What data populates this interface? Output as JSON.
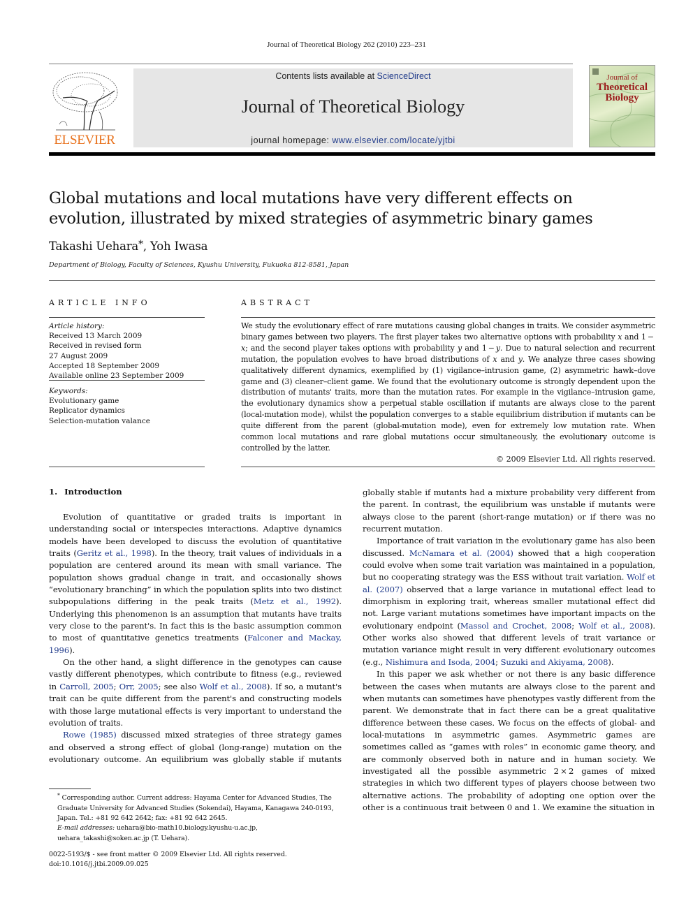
{
  "running_head": "Journal of Theoretical Biology 262 (2010) 223–231",
  "masthead": {
    "publisher": "ELSEVIER",
    "contents_prefix": "Contents lists available at ",
    "contents_link": "ScienceDirect",
    "journal_name": "Journal of Theoretical Biology",
    "homepage_prefix": "journal homepage: ",
    "homepage_link": "www.elsevier.com/locate/yjtbi",
    "cover": {
      "line1": "Journal of",
      "line2": "Theoretical",
      "line3": "Biology"
    }
  },
  "article": {
    "title": "Global mutations and local mutations have very different effects on evolution, illustrated by mixed strategies of asymmetric binary games",
    "author1": "Takashi Uehara",
    "author1_mark": "*",
    "author_sep": ", ",
    "author2": "Yoh Iwasa",
    "affiliation": "Department of Biology, Faculty of Sciences, Kyushu University, Fukuoka 812-8581, Japan"
  },
  "article_info": {
    "heading": "ARTICLE INFO",
    "history_label": "Article history:",
    "history": [
      "Received 13 March 2009",
      "Received in revised form",
      "27 August 2009",
      "Accepted 18 September 2009",
      "Available online 23 September 2009"
    ],
    "keywords_label": "Keywords:",
    "keywords": [
      "Evolutionary game",
      "Replicator dynamics",
      "Selection-mutation valance"
    ]
  },
  "abstract": {
    "heading": "ABSTRACT",
    "s1": "We study the evolutionary effect of rare mutations causing global changes in traits. We consider asymmetric binary games between two players. The first player takes two alternative options with probability ",
    "x": "x",
    "s2": " and 1 − ",
    "s3": "; and the second player takes options with probability ",
    "y": "y",
    "s4": " and 1 − ",
    "s5": ". Due to natural selection and recurrent mutation, the population evolves to have broad distributions of ",
    "s6": " and ",
    "s7": ". We analyze three cases showing qualitatively different dynamics, exemplified by (1) vigilance–intrusion game, (2) asymmetric hawk–dove game and (3) cleaner–client game. We found that the evolutionary outcome is strongly dependent upon the distribution of mutants' traits, more than the mutation rates. For example in the vigilance–intrusion game, the evolutionary dynamics show a perpetual stable oscillation if mutants are always close to the parent (local-mutation mode), whilst the population converges to a stable equilibrium distribution if mutants can be quite different from the parent (global-mutation mode), even for extremely low mutation rate. When common local mutations and rare global mutations occur simultaneously, the evolutionary outcome is controlled by the latter.",
    "copyright": "© 2009 Elsevier Ltd. All rights reserved."
  },
  "introduction": {
    "number": "1.",
    "heading": "Introduction",
    "p1_a": "Evolution of quantitative or graded traits is important in understanding social or interspecies interactions. Adaptive dynamics models have been developed to discuss the evolution of quantitative traits (",
    "p1_ref1": "Geritz et al., 1998",
    "p1_b": "). In the theory, trait values of individuals in a population are centered around its mean with small variance. The population shows gradual change in trait, and occasionally shows “evolutionary branching” in which the population splits into two distinct subpopulations differing in the peak traits (",
    "p1_ref2": "Metz et al., 1992",
    "p1_c": "). Underlying this phenomenon is an assumption that mutants have traits very close to the parent's. In fact this is the basic assumption common to most of quantitative genetics treatments (",
    "p1_ref3": "Falconer and Mackay, 1996",
    "p1_d": ").",
    "p2_a": "On the other hand, a slight difference in the genotypes can cause vastly different phenotypes, which contribute to fitness (e.g., reviewed in ",
    "p2_ref1": "Carroll, 2005",
    "p2_b": "; ",
    "p2_ref2": "Orr, 2005",
    "p2_c": "; see also ",
    "p2_ref3": "Wolf et al., 2008",
    "p2_d": "). If so, a mutant's trait can be quite different from the parent's and constructing models with those large mutational effects is very important to understand the evolution of traits.",
    "p3_ref1": "Rowe (1985)",
    "p3_a": " discussed mixed strategies of three strategy games and observed a strong effect of global (long-range) mutation on the evolutionary outcome. An equilibrium was globally stable if mutants had a mixture probability very different from the parent. In contrast, the equilibrium was unstable if mutants were always close to the parent (short-range mutation) or if there was no recurrent mutation.",
    "p4_a": "Importance of trait variation in the evolutionary game has also been discussed. ",
    "p4_ref1": "McNamara et al. (2004)",
    "p4_b": " showed that a high cooperation could evolve when some trait variation was maintained in a population, but no cooperating strategy was the ESS without trait variation. ",
    "p4_ref2": "Wolf et al. (2007)",
    "p4_c": " observed that a large variance in mutational effect lead to dimorphism in exploring trait, whereas smaller mutational effect did not. Large variant mutations sometimes have important impacts on the evolutionary endpoint (",
    "p4_ref3": "Massol and Crochet, 2008",
    "p4_d": "; ",
    "p4_ref4": "Wolf et al., 2008",
    "p4_e": "). Other works also showed that different levels of trait variance or mutation variance might result in very different evolutionary outcomes (e.g., ",
    "p4_ref5": "Nishimura and Isoda, 2004",
    "p4_f": "; ",
    "p4_ref6": "Suzuki and Akiyama, 2008",
    "p4_g": ").",
    "p5_a": "In this paper we ask whether or not there is any basic difference between the cases when mutants are always close to the parent and when mutants can sometimes have phenotypes vastly different from the parent. We demonstrate that in fact there can be a great qualitative difference between these cases. We focus on the effects of global- and local-mutations in asymmetric games. Asymmetric games are sometimes called as “games with roles” in economic game theory, and are commonly observed both in nature and in human society. We investigated all the possible asymmetric 2 × 2 games of mixed strategies in which two different types of players choose between two alternative actions. The probability of adopting one option over the other is a continuous trait between 0 and 1. We examine the situation in"
  },
  "footnote": {
    "mark": "*",
    "corresponding": " Corresponding author. Current address: Hayama Center for Advanced Studies, The Graduate University for Advanced Studies (Sokendai), Hayama, Kanagawa 240-0193, Japan. Tel.: +81 92 642 2642; fax: +81 92 642 2645.",
    "email_label": "E-mail addresses:",
    "emails": " uehara@bio-math10.biology.kyushu-u.ac.jp, uehara_takashi@soken.ac.jp (T. Uehara)."
  },
  "front_matter": {
    "issn_line": "0022-5193/$ - see front matter © 2009 Elsevier Ltd. All rights reserved.",
    "doi": "doi:10.1016/j.jtbi.2009.09.025"
  },
  "colors": {
    "link": "#1f3a8a",
    "elsevier_orange": "#e8711c",
    "masthead_gray": "#e6e6e6",
    "cover_title": "#9b1c1c"
  }
}
